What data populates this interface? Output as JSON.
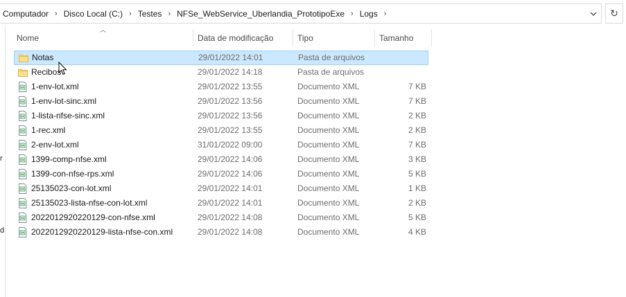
{
  "breadcrumb": [
    "Computador",
    "Disco Local (C:)",
    "Testes",
    "NFSe_WebService_Uberlandia_PrototipoExe",
    "Logs"
  ],
  "icons": {
    "dropdown": "chevron-down-icon",
    "refresh": "refresh-icon",
    "folder": "folder-icon",
    "xml": "xml-file-icon"
  },
  "left_pane_fragments": [
    "r",
    "d"
  ],
  "columns": {
    "name": "Nome",
    "date": "Data de modificação",
    "type": "Tipo",
    "size": "Tamanho"
  },
  "colors": {
    "selection": "#cce8ff",
    "selection_border": "#99d1ff",
    "folder": "#f8d775"
  },
  "files": [
    {
      "name": "Notas",
      "date": "29/01/2022 14:01",
      "type": "Pasta de arquivos",
      "size": "",
      "kind": "folder",
      "selected": true
    },
    {
      "name": "Recibos",
      "date": "29/01/2022 14:18",
      "type": "Pasta de arquivos",
      "size": "",
      "kind": "folder"
    },
    {
      "name": "1-env-lot.xml",
      "date": "29/01/2022 13:55",
      "type": "Documento XML",
      "size": "7 KB",
      "kind": "xml"
    },
    {
      "name": "1-env-lot-sinc.xml",
      "date": "29/01/2022 13:56",
      "type": "Documento XML",
      "size": "7 KB",
      "kind": "xml"
    },
    {
      "name": "1-lista-nfse-sinc.xml",
      "date": "29/01/2022 13:56",
      "type": "Documento XML",
      "size": "2 KB",
      "kind": "xml"
    },
    {
      "name": "1-rec.xml",
      "date": "29/01/2022 13:55",
      "type": "Documento XML",
      "size": "2 KB",
      "kind": "xml"
    },
    {
      "name": "2-env-lot.xml",
      "date": "31/01/2022 09:00",
      "type": "Documento XML",
      "size": "7 KB",
      "kind": "xml"
    },
    {
      "name": "1399-comp-nfse.xml",
      "date": "29/01/2022 14:06",
      "type": "Documento XML",
      "size": "3 KB",
      "kind": "xml"
    },
    {
      "name": "1399-con-nfse-rps.xml",
      "date": "29/01/2022 14:06",
      "type": "Documento XML",
      "size": "5 KB",
      "kind": "xml"
    },
    {
      "name": "25135023-con-lot.xml",
      "date": "29/01/2022 14:01",
      "type": "Documento XML",
      "size": "1 KB",
      "kind": "xml"
    },
    {
      "name": "25135023-lista-nfse-con-lot.xml",
      "date": "29/01/2022 14:01",
      "type": "Documento XML",
      "size": "2 KB",
      "kind": "xml"
    },
    {
      "name": "2022012920220129-con-nfse.xml",
      "date": "29/01/2022 14:08",
      "type": "Documento XML",
      "size": "5 KB",
      "kind": "xml"
    },
    {
      "name": "2022012920220129-lista-nfse-con.xml",
      "date": "29/01/2022 14:08",
      "type": "Documento XML",
      "size": "4 KB",
      "kind": "xml"
    }
  ]
}
